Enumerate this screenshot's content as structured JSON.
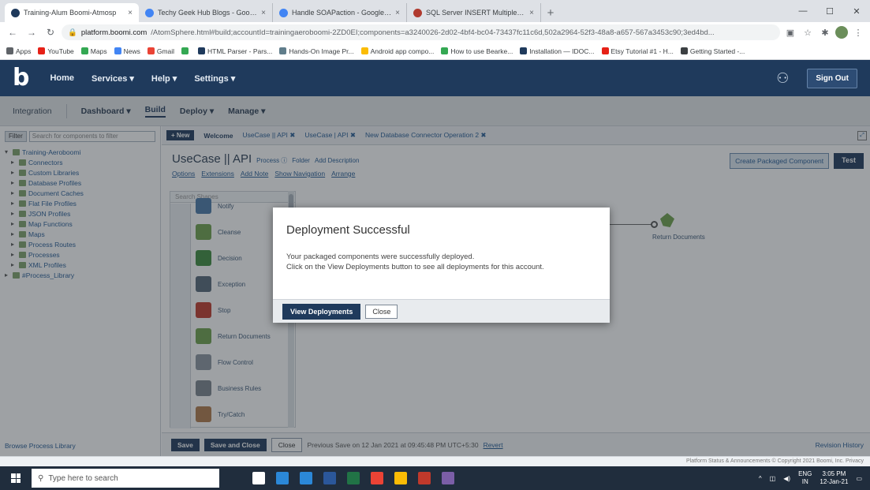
{
  "browser": {
    "tabs": [
      {
        "title": "Training-Alum Boomi-Atmosp",
        "favcolor": "#1f3a5c",
        "active": true
      },
      {
        "title": "Techy Geek Hub Blogs - Google",
        "favcolor": "#4285f4",
        "active": false
      },
      {
        "title": "Handle SOAPaction - Google Do",
        "favcolor": "#4285f4",
        "active": false
      },
      {
        "title": "SQL Server INSERT Multiple Row",
        "favcolor": "#b03a2e",
        "active": false
      }
    ],
    "url_host": "platform.boomi.com",
    "url_path": "/AtomSphere.html#build;accountId=trainingaeroboomi-2ZD0EI;components=a3240026-2d02-4bf4-bc04-73437fc11c6d,502a2964-52f3-48a8-a657-567a3453c90;3ed4bd...",
    "bookmarks": [
      {
        "label": "Apps",
        "color": "#5f6368"
      },
      {
        "label": "YouTube",
        "color": "#e62117"
      },
      {
        "label": "Maps",
        "color": "#34a853"
      },
      {
        "label": "News",
        "color": "#4285f4"
      },
      {
        "label": "Gmail",
        "color": "#ea4335"
      },
      {
        "label": "",
        "color": "#34a853"
      },
      {
        "label": "HTML Parser - Pars...",
        "color": "#1f3a5c"
      },
      {
        "label": "Hands-On Image Pr...",
        "color": "#607d8b"
      },
      {
        "label": "Android app compo...",
        "color": "#fbbc05"
      },
      {
        "label": "How to use Bearke...",
        "color": "#34a853"
      },
      {
        "label": "Installation — IDOC...",
        "color": "#1f3a5c"
      },
      {
        "label": "Etsy Tutorial #1 - H...",
        "color": "#e62117"
      },
      {
        "label": "Getting Started -...",
        "color": "#3c4043"
      }
    ]
  },
  "app": {
    "logo": "b",
    "nav": [
      "Home",
      "Services ▾",
      "Help ▾",
      "Settings ▾"
    ],
    "sign_out": "Sign Out",
    "subnav": {
      "integration": "Integration",
      "dashboard": "Dashboard ▾",
      "build": "Build",
      "deploy": "Deploy ▾",
      "manage": "Manage ▾"
    }
  },
  "left_panel": {
    "filter": "Filter",
    "search_placeholder": "Search for components to filter",
    "tree": [
      {
        "label": "Training-Aeroboomi",
        "level": 0,
        "exp": "▾"
      },
      {
        "label": "Connectors",
        "level": 1,
        "exp": "▸"
      },
      {
        "label": "Custom Libraries",
        "level": 1,
        "exp": "▸"
      },
      {
        "label": "Database Profiles",
        "level": 1,
        "exp": "▸"
      },
      {
        "label": "Document Caches",
        "level": 1,
        "exp": "▸"
      },
      {
        "label": "Flat File Profiles",
        "level": 1,
        "exp": "▸"
      },
      {
        "label": "JSON Profiles",
        "level": 1,
        "exp": "▸"
      },
      {
        "label": "Map Functions",
        "level": 1,
        "exp": "▸"
      },
      {
        "label": "Maps",
        "level": 1,
        "exp": "▸"
      },
      {
        "label": "Process Routes",
        "level": 1,
        "exp": "▸"
      },
      {
        "label": "Processes",
        "level": 1,
        "exp": "▸"
      },
      {
        "label": "XML Profiles",
        "level": 1,
        "exp": "▸"
      },
      {
        "label": "#Process_Library",
        "level": 0,
        "exp": "▸"
      }
    ],
    "browse": "Browse Process Library"
  },
  "canvas": {
    "new_btn": "+ New",
    "tabs": [
      {
        "label": "Welcome",
        "bold": true
      },
      {
        "label": "UseCase || API ✖"
      },
      {
        "label": "UseCase | API ✖"
      },
      {
        "label": "New Database Connector Operation 2 ✖"
      }
    ],
    "process_name": "UseCase || API",
    "process_tag": "Process ⓘ",
    "folder": "Folder",
    "add_desc": "Add Description",
    "links": [
      "Options",
      "Extensions",
      "Add Note",
      "Show Navigation",
      "Arrange"
    ],
    "create_pkg": "Create Packaged Component",
    "test": "Test",
    "search_shapes": "Search Shapes",
    "shapes": [
      {
        "label": "Notify",
        "color": "#4a78a8"
      },
      {
        "label": "Cleanse",
        "color": "#6ea04c"
      },
      {
        "label": "Decision",
        "color": "#3c8a3c"
      },
      {
        "label": "Exception",
        "color": "#556677"
      },
      {
        "label": "Stop",
        "color": "#c0392b"
      },
      {
        "label": "Return Documents",
        "color": "#6ea04c"
      },
      {
        "label": "Flow Control",
        "color": "#8a949e"
      },
      {
        "label": "Business Rules",
        "color": "#7a838c"
      },
      {
        "label": "Try/Catch",
        "color": "#b0784a"
      }
    ],
    "flow_label": "Return Documents",
    "footer": {
      "save": "Save",
      "save_close": "Save and Close",
      "close": "Close",
      "status": "Previous Save on 12 Jan 2021 at 09:45:48 PM UTC+5:30",
      "revert": "Revert",
      "version": "Revision History"
    }
  },
  "statusbar": "Platform Status & Announcements    © Copyright 2021 Boomi, Inc.    Privacy",
  "modal": {
    "title": "Deployment Successful",
    "line1": "Your packaged components were successfully deployed.",
    "line2": "Click on the View Deployments button to see all deployments for this account.",
    "view": "View Deployments",
    "close": "Close"
  },
  "taskbar": {
    "search": "Type here to search",
    "apps": [
      "#ffffff",
      "#2b88d8",
      "#2b88d8",
      "#2b579a",
      "#217346",
      "#ea4335",
      "#fbbc05",
      "#c0392b",
      "#7b5ea7"
    ],
    "lang": "ENG",
    "region": "IN",
    "time": "3:05 PM",
    "date": "12-Jan-21"
  },
  "colors": {
    "brand": "#1f3a5c",
    "accent": "#6ea04c"
  }
}
